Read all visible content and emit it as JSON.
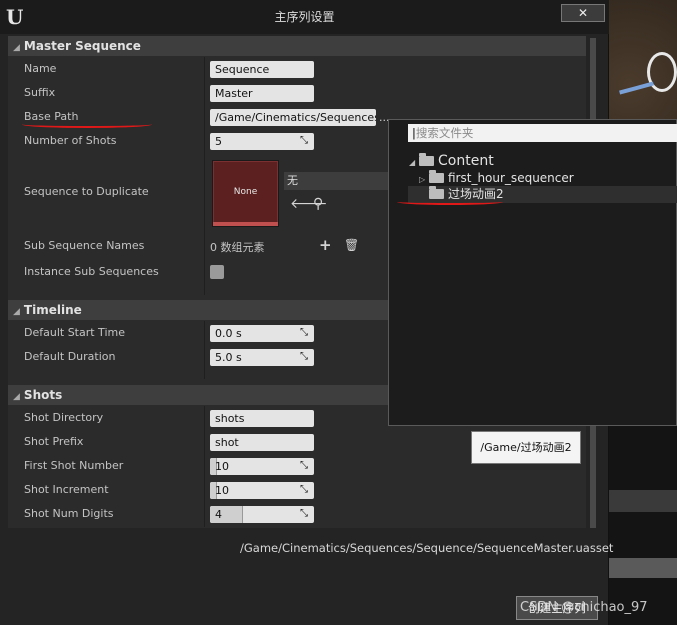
{
  "window": {
    "title": "主序列设置",
    "close_icon": "close-icon"
  },
  "categories": {
    "master_sequence": "Master Sequence",
    "timeline": "Timeline",
    "shots": "Shots"
  },
  "master_sequence": {
    "name_label": "Name",
    "name_value": "Sequence",
    "suffix_label": "Suffix",
    "suffix_value": "Master",
    "base_path_label": "Base Path",
    "base_path_value": "/Game/Cinematics/Sequences",
    "base_path_browse": "...",
    "num_shots_label": "Number of Shots",
    "num_shots_value": "5",
    "seq_dup_label": "Sequence to Duplicate",
    "seq_dup_thumb": "None",
    "seq_dup_value": "无",
    "sub_names_label": "Sub Sequence Names",
    "sub_names_value": "0 数组元素",
    "instance_sub_label": "Instance Sub Sequences",
    "instance_sub_checked": false
  },
  "timeline": {
    "start_label": "Default Start Time",
    "start_value": "0.0 s",
    "duration_label": "Default Duration",
    "duration_value": "5.0 s"
  },
  "shots": {
    "directory_label": "Shot Directory",
    "directory_value": "shots",
    "prefix_label": "Shot Prefix",
    "prefix_value": "shot",
    "first_label": "First Shot Number",
    "first_value": "10",
    "increment_label": "Shot Increment",
    "increment_value": "10",
    "digits_label": "Shot Num Digits",
    "digits_value": "4"
  },
  "footer": {
    "asset_path": "/Game/Cinematics/Sequences/Sequence/SequenceMaster.uasset",
    "create_button": "创建主序列"
  },
  "folder_picker": {
    "search_placeholder": "搜索文件夹",
    "root": "Content",
    "items": [
      "first_hour_sequencer",
      "过场动画2"
    ],
    "selected": "过场动画2",
    "tooltip": "/Game/过场动画2"
  },
  "watermark": "CSDN @chichao_97",
  "colors": {
    "annotation": "#e01818",
    "thumbnail": "#5c2020"
  }
}
